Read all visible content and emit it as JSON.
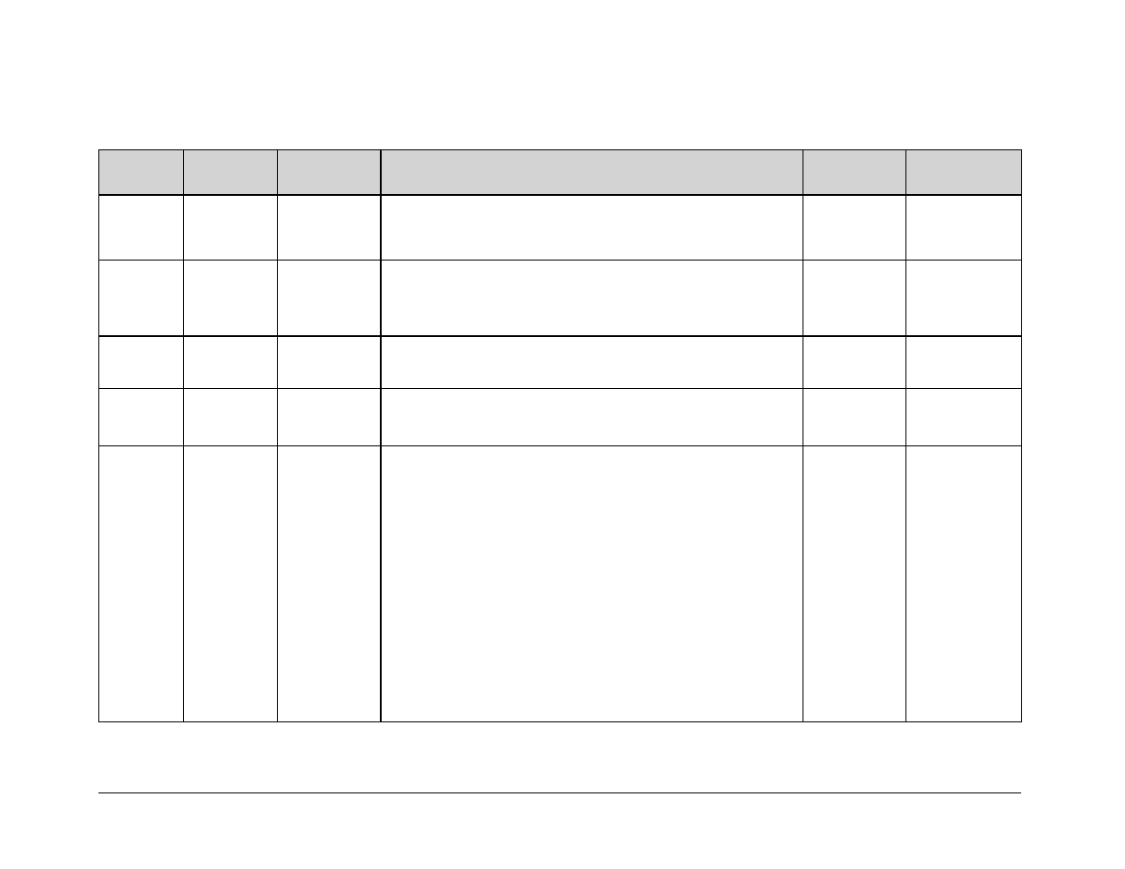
{
  "table": {
    "headers": [
      "",
      "",
      "",
      "",
      "",
      ""
    ],
    "rows": [
      [
        "",
        "",
        "",
        "",
        "",
        ""
      ],
      [
        "",
        "",
        "",
        "",
        "",
        ""
      ],
      [
        "",
        "",
        "",
        "",
        "",
        ""
      ],
      [
        "",
        "",
        "",
        "",
        "",
        ""
      ],
      [
        "",
        "",
        "",
        "",
        "",
        ""
      ]
    ]
  }
}
